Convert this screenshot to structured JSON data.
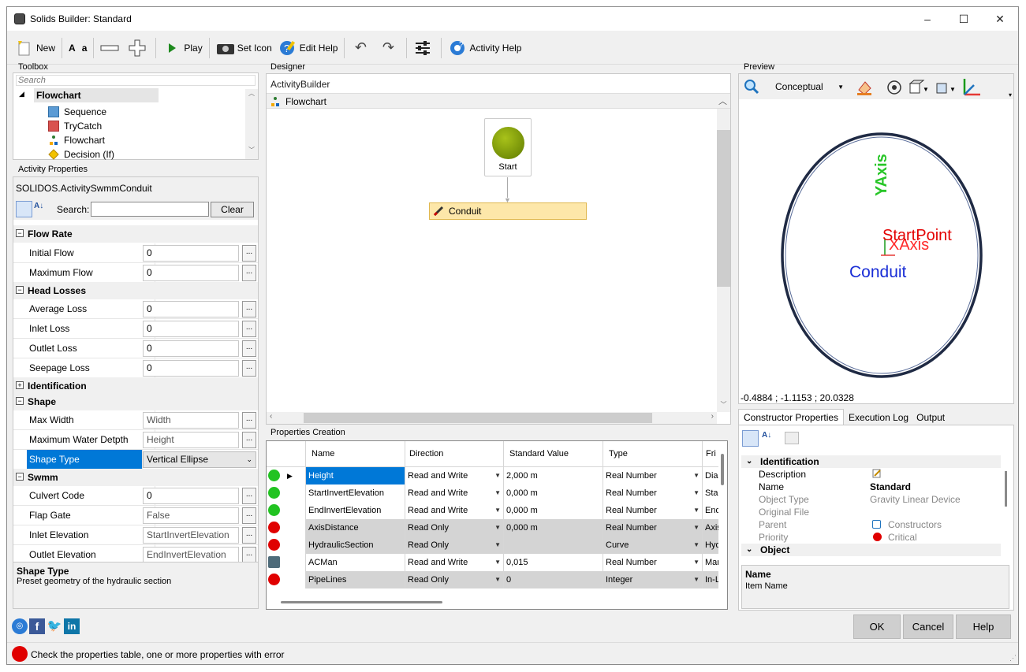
{
  "window": {
    "title": "Solids Builder: Standard",
    "controls": [
      "–",
      "☐",
      "✕"
    ]
  },
  "toolbar": {
    "new": "New",
    "bold_a": "A",
    "small_a": "a",
    "play": "Play",
    "set_icon": "Set Icon",
    "edit_help": "Edit Help",
    "activity_help": "Activity Help"
  },
  "toolbox": {
    "label": "Toolbox",
    "search_placeholder": "Search",
    "root": "Flowchart",
    "items": [
      "Sequence",
      "TryCatch",
      "Flowchart",
      "Decision (If)"
    ]
  },
  "activity_properties": {
    "label": "Activity Properties",
    "object": "SOLIDOS.ActivitySwmmConduit",
    "search_label": "Search:",
    "clear": "Clear",
    "cat_flow": "Flow Rate",
    "cat_head": "Head Losses",
    "cat_ident": "Identification",
    "cat_shape": "Shape",
    "cat_swmm": "Swmm",
    "props": [
      {
        "name": "Initial Flow",
        "value": "0"
      },
      {
        "name": "Maximum Flow",
        "value": "0"
      },
      {
        "name": "Average Loss",
        "value": "0"
      },
      {
        "name": "Inlet Loss",
        "value": "0"
      },
      {
        "name": "Outlet Loss",
        "value": "0"
      },
      {
        "name": "Seepage Loss",
        "value": "0"
      },
      {
        "name": "Max Width",
        "value": "Width"
      },
      {
        "name": "Maximum Water Detpth",
        "value": "Height"
      },
      {
        "name": "Shape Type",
        "value": "Vertical Ellipse"
      },
      {
        "name": "Culvert Code",
        "value": "0"
      },
      {
        "name": "Flap Gate",
        "value": "False"
      },
      {
        "name": "Inlet Elevation",
        "value": "StartInvertElevation"
      },
      {
        "name": "Outlet Elevation",
        "value": "EndInvertElevation"
      }
    ],
    "desc_title": "Shape Type",
    "desc_text": "Preset geometry of the hydraulic section"
  },
  "designer": {
    "label": "Designer",
    "breadcrumb": "ActivityBuilder",
    "root": "Flowchart",
    "start": "Start",
    "node": "Conduit"
  },
  "properties_creation": {
    "label": "Properties Creation",
    "columns": [
      "Name",
      "Direction",
      "Standard Value",
      "Type",
      "Fri"
    ],
    "rows": [
      {
        "status": "green",
        "name": "Height",
        "direction": "Read and Write",
        "value": "2,000 m",
        "type": "Real Number",
        "extra": "Dia"
      },
      {
        "status": "green",
        "name": "StartInvertElevation",
        "direction": "Read and Write",
        "value": "0,000 m",
        "type": "Real Number",
        "extra": "Sta"
      },
      {
        "status": "green",
        "name": "EndInvertElevation",
        "direction": "Read and Write",
        "value": "0,000 m",
        "type": "Real Number",
        "extra": "End"
      },
      {
        "status": "red",
        "name": "AxisDistance",
        "direction": "Read Only",
        "value": "0,000 m",
        "type": "Real Number",
        "extra": "Axis"
      },
      {
        "status": "red",
        "name": "HydraulicSection",
        "direction": "Read Only",
        "value": "",
        "type": "Curve",
        "extra": "Hyd"
      },
      {
        "status": "gear",
        "name": "ACMan",
        "direction": "Read and Write",
        "value": "0,015",
        "type": "Real Number",
        "extra": "Man"
      },
      {
        "status": "red",
        "name": "PipeLines",
        "direction": "Read Only",
        "value": "0",
        "type": "Integer",
        "extra": "In-L"
      }
    ]
  },
  "preview": {
    "label": "Preview",
    "visual_style": "Conceptual",
    "y_axis": "YAxis",
    "x_axis": "XAxis",
    "start_point": "StartPoint",
    "name": "Conduit",
    "coords": "-0.4884 ; -1.1153 ; 20.0328"
  },
  "constructor": {
    "tabs": [
      "Constructor Properties",
      "Execution Log",
      "Output"
    ],
    "cat_ident": "Identification",
    "cat_object": "Object",
    "rows": [
      {
        "name": "Description",
        "value": ""
      },
      {
        "name": "Name",
        "value": "Standard"
      },
      {
        "name": "Object Type",
        "value": "Gravity Linear Device"
      },
      {
        "name": "Original File",
        "value": ""
      },
      {
        "name": "Parent",
        "value": "Constructors"
      },
      {
        "name": "Priority",
        "value": "Critical"
      }
    ],
    "desc_title": "Name",
    "desc_text": "Item Name"
  },
  "buttons": {
    "ok": "OK",
    "cancel": "Cancel",
    "help": "Help"
  },
  "status": {
    "message": "Check the properties table, one or more properties with error"
  },
  "colors": {
    "accent": "#0078d7",
    "error": "#e00000",
    "ok": "#22c322",
    "node_bg": "#fde7a9"
  }
}
